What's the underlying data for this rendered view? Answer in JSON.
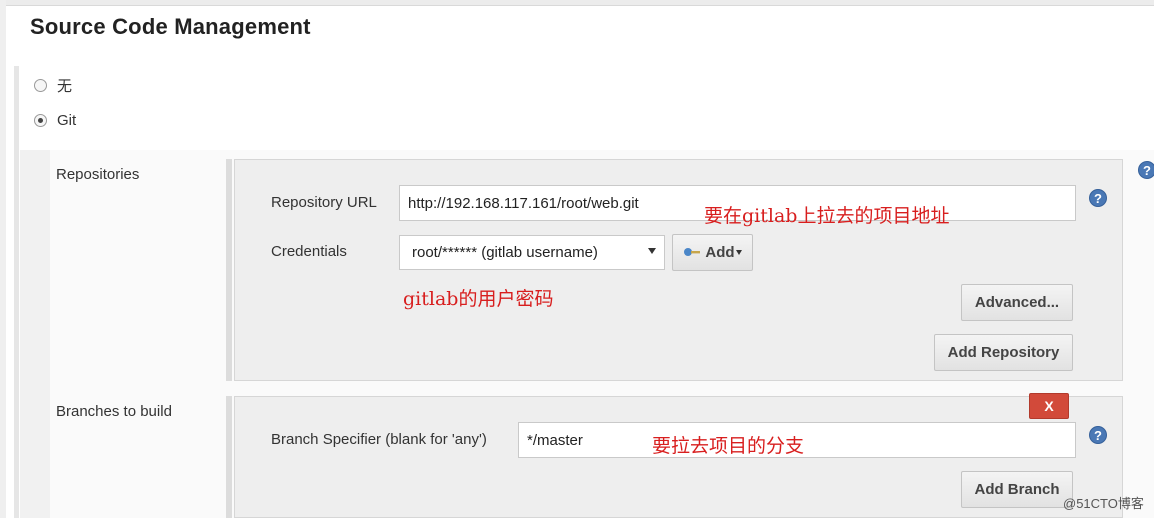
{
  "section": {
    "title": "Source Code Management"
  },
  "scm_options": [
    {
      "label": "无",
      "selected": false
    },
    {
      "label": "Git",
      "selected": true
    }
  ],
  "repositories": {
    "label": "Repositories",
    "url_label": "Repository URL",
    "url_value": "http://192.168.117.161/root/web.git",
    "credentials_label": "Credentials",
    "credentials_value": "root/****** (gitlab username)",
    "add_label": "Add",
    "advanced_label": "Advanced...",
    "add_repository_label": "Add Repository"
  },
  "branches": {
    "label": "Branches to build",
    "specifier_label": "Branch Specifier (blank for 'any')",
    "specifier_value": "*/master",
    "delete_label": "X",
    "add_branch_label": "Add Branch"
  },
  "annotations": {
    "url_note": "要在gitlab上拉去的项目地址",
    "credentials_note": "gitlab的用户密码",
    "branch_note": "要拉去项目的分支"
  },
  "help": {
    "symbol": "?"
  },
  "watermark": "@51CTO博客",
  "icons": {
    "key": "key-icon",
    "help": "help-icon",
    "caret": "caret-down-icon"
  },
  "colors": {
    "annotation": "#d81e1e",
    "help": "#4a78b5",
    "delete": "#d24a3a"
  }
}
